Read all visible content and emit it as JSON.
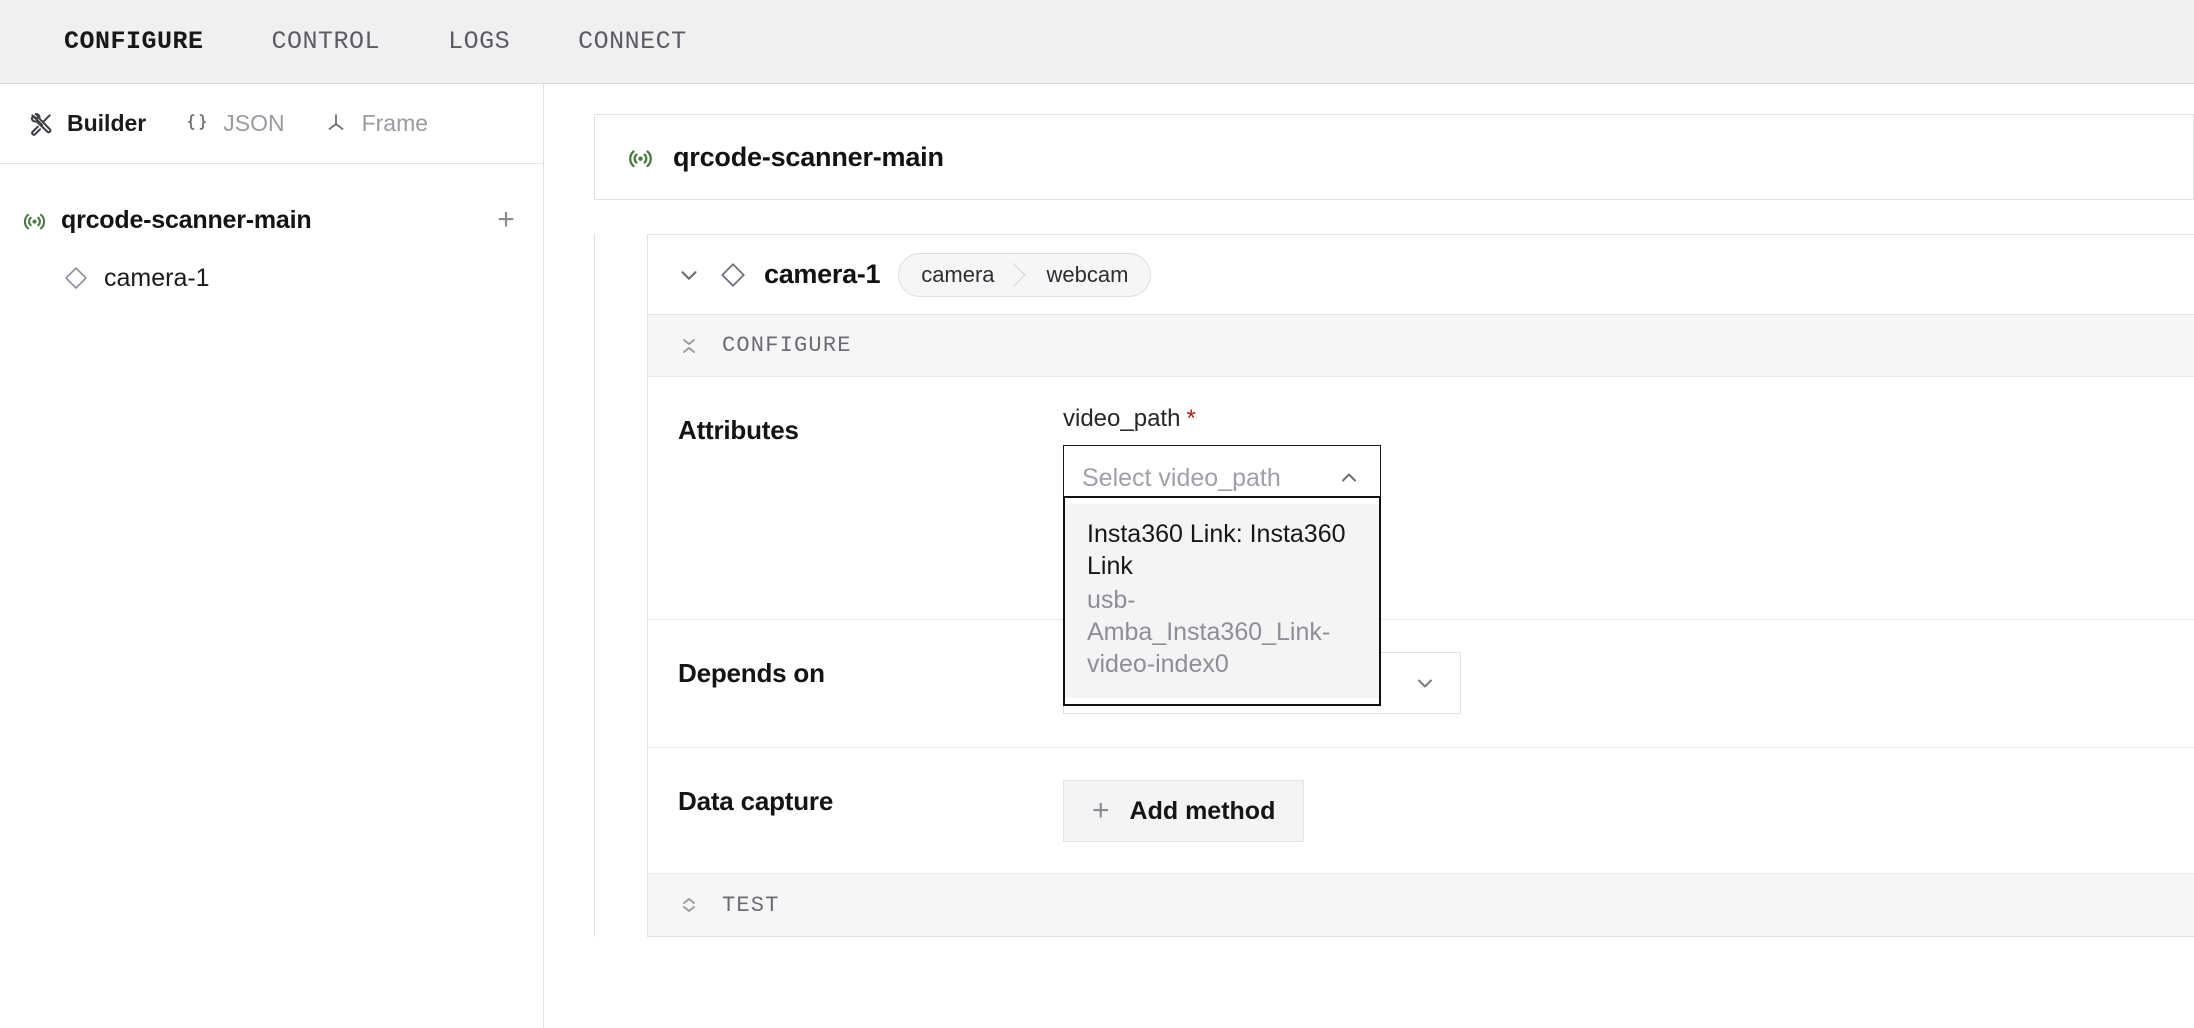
{
  "topnav": {
    "tabs": [
      {
        "label": "CONFIGURE",
        "active": true
      },
      {
        "label": "CONTROL",
        "active": false
      },
      {
        "label": "LOGS",
        "active": false
      },
      {
        "label": "CONNECT",
        "active": false
      }
    ]
  },
  "modebar": {
    "items": [
      {
        "label": "Builder",
        "icon": "wrench-screwdriver-icon",
        "active": true
      },
      {
        "label": "JSON",
        "icon": "curly-braces-icon",
        "active": false
      },
      {
        "label": "Frame",
        "icon": "frame-tree-icon",
        "active": false
      }
    ]
  },
  "sidebar": {
    "machine": {
      "name": "qrcode-scanner-main",
      "icon": "machine-signal-icon",
      "add_label": "+"
    },
    "children": [
      {
        "name": "camera-1",
        "icon": "diamond-icon"
      }
    ]
  },
  "main": {
    "machine_card": {
      "title": "qrcode-scanner-main",
      "icon": "machine-signal-icon"
    },
    "resource": {
      "title": "camera-1",
      "icon": "diamond-icon",
      "collapse_icon": "chevron-down-icon",
      "badge": {
        "type": "camera",
        "model": "webcam"
      },
      "sections": {
        "configure": {
          "label": "CONFIGURE",
          "icon": "collapse-icon"
        },
        "test": {
          "label": "TEST",
          "icon": "expand-icon"
        }
      },
      "rows": {
        "attributes": {
          "label": "Attributes",
          "field_label": "video_path",
          "required_marker": "*",
          "select_placeholder": "Select video_path",
          "select_caret": "chevron-up-icon",
          "dropdown": {
            "open": true,
            "options": [
              {
                "primary": "Insta360 Link: Insta360 Link",
                "secondary": "usb-Amba_Insta360_Link-video-index0",
                "highlighted": true
              }
            ]
          }
        },
        "depends_on": {
          "label": "Depends on",
          "value": "",
          "caret": "chevron-down-icon"
        },
        "data_capture": {
          "label": "Data capture",
          "button_label": "Add method",
          "button_icon": "plus-icon"
        }
      }
    }
  },
  "colors": {
    "accent_green": "#4b7a42",
    "required_red": "#b81d13",
    "topnav_bg": "#f0f0f1",
    "section_bg": "#f6f6f7",
    "border": "#e2e2e4"
  }
}
